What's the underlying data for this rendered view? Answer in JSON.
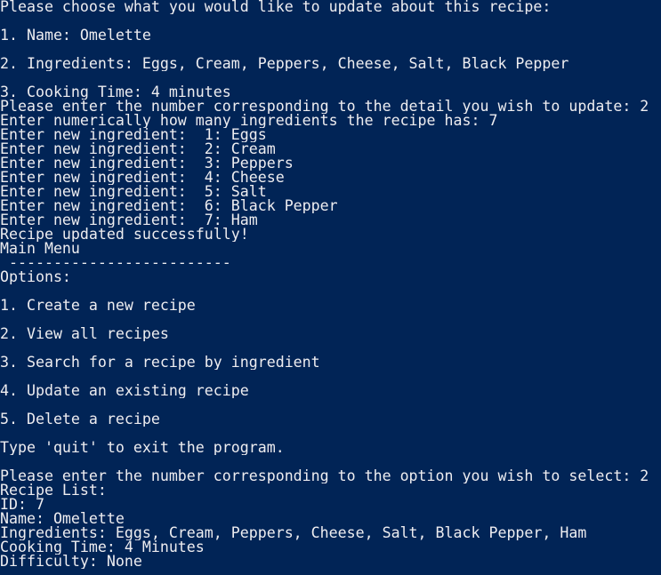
{
  "terminal": {
    "background": "#012456",
    "foreground": "#eeedf0",
    "lines": [
      "Please choose what you would like to update about this recipe:",
      "",
      "1. Name: Omelette",
      "",
      "2. Ingredients: Eggs, Cream, Peppers, Cheese, Salt, Black Pepper",
      "",
      "3. Cooking Time: 4 minutes",
      "Please enter the number corresponding to the detail you wish to update: 2",
      "Enter numerically how many ingredients the recipe has: 7",
      "Enter new ingredient:  1: Eggs",
      "Enter new ingredient:  2: Cream",
      "Enter new ingredient:  3: Peppers",
      "Enter new ingredient:  4: Cheese",
      "Enter new ingredient:  5: Salt",
      "Enter new ingredient:  6: Black Pepper",
      "Enter new ingredient:  7: Ham",
      "Recipe updated successfully!",
      "Main Menu",
      " -------------------------",
      "Options:",
      "",
      "1. Create a new recipe",
      "",
      "2. View all recipes",
      "",
      "3. Search for a recipe by ingredient",
      "",
      "4. Update an existing recipe",
      "",
      "5. Delete a recipe",
      "",
      "Type 'quit' to exit the program.",
      "",
      "Please enter the number corresponding to the option you wish to select: 2",
      "Recipe List:",
      "ID: 7",
      "Name: Omelette",
      "Ingredients: Eggs, Cream, Peppers, Cheese, Salt, Black Pepper, Ham",
      "Cooking Time: 4 Minutes",
      "Difficulty: None"
    ]
  }
}
